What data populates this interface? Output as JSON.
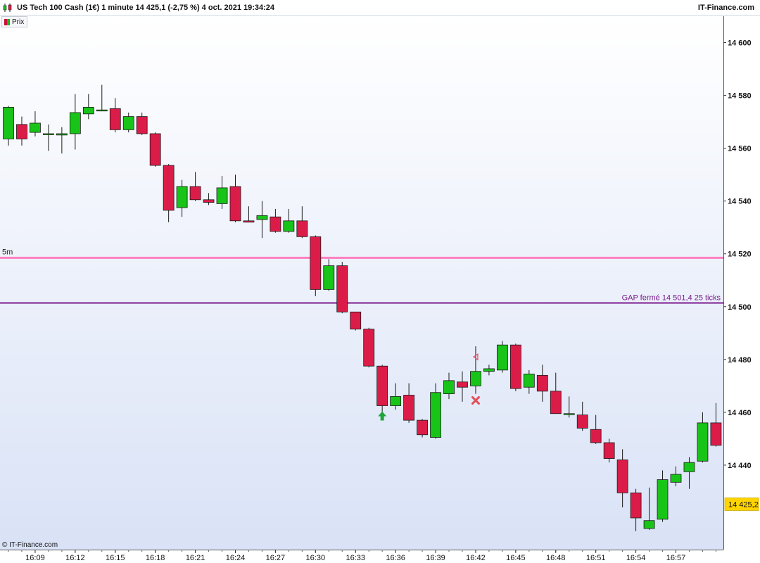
{
  "header": {
    "title": "US Tech 100 Cash (1€) 1 minute 14 425,1 (-2,75 %) 4 oct. 2021 19:34:24",
    "brand": "IT-Finance.com",
    "legend_label": "Prix"
  },
  "footer": {
    "copyright": "© IT-Finance.com"
  },
  "colors": {
    "up": "#18c418",
    "down": "#dc1c48",
    "pink_line": "#ff7fc0",
    "purple_line": "#7a1a8c",
    "bg_top": "#ffffff",
    "bg_bottom": "#d9e2f6"
  },
  "chart_data": {
    "type": "candlestick",
    "instrument": "US Tech 100 Cash (1€)",
    "interval": "1 minute",
    "ylim": [
      14408,
      14610
    ],
    "y_ticks": [
      14440,
      14460,
      14480,
      14500,
      14520,
      14540,
      14560,
      14580,
      14600
    ],
    "y_tick_labels": [
      "14 440",
      "14 460",
      "14 480",
      "14 500",
      "14 520",
      "14 540",
      "14 560",
      "14 580",
      "14 600"
    ],
    "x_tick_labels": [
      "16:09",
      "16:12",
      "16:15",
      "16:18",
      "16:21",
      "16:24",
      "16:27",
      "16:30",
      "16:33",
      "16:36",
      "16:39",
      "16:42",
      "16:45",
      "16:48",
      "16:51",
      "16:54",
      "16:57"
    ],
    "x_tick_candle_index": [
      2,
      5,
      8,
      11,
      14,
      17,
      20,
      23,
      26,
      29,
      32,
      35,
      38,
      41,
      44,
      47,
      50
    ],
    "candles": [
      {
        "o": 14563.5,
        "h": 14576,
        "l": 14561,
        "c": 14575.5
      },
      {
        "o": 14569,
        "h": 14572,
        "l": 14561,
        "c": 14563.5
      },
      {
        "o": 14566,
        "h": 14574,
        "l": 14564.5,
        "c": 14569.5
      },
      {
        "o": 14565.5,
        "h": 14569,
        "l": 14559,
        "c": 14565.5
      },
      {
        "o": 14565,
        "h": 14568,
        "l": 14558,
        "c": 14565.5
      },
      {
        "o": 14565.5,
        "h": 14580.5,
        "l": 14559.5,
        "c": 14573.5
      },
      {
        "o": 14573,
        "h": 14580.5,
        "l": 14571,
        "c": 14575.5
      },
      {
        "o": 14574.5,
        "h": 14584,
        "l": 14574,
        "c": 14574.5
      },
      {
        "o": 14575,
        "h": 14579,
        "l": 14566,
        "c": 14567
      },
      {
        "o": 14567,
        "h": 14573.5,
        "l": 14566,
        "c": 14572
      },
      {
        "o": 14572,
        "h": 14573.5,
        "l": 14565,
        "c": 14565.5
      },
      {
        "o": 14565.5,
        "h": 14566,
        "l": 14553,
        "c": 14553.5
      },
      {
        "o": 14553.5,
        "h": 14554,
        "l": 14532,
        "c": 14536.5
      },
      {
        "o": 14537.5,
        "h": 14548,
        "l": 14534,
        "c": 14545.5
      },
      {
        "o": 14545.5,
        "h": 14551,
        "l": 14540,
        "c": 14540.5
      },
      {
        "o": 14540.5,
        "h": 14543,
        "l": 14538.5,
        "c": 14539.5
      },
      {
        "o": 14539,
        "h": 14549.5,
        "l": 14537,
        "c": 14545
      },
      {
        "o": 14545.5,
        "h": 14550,
        "l": 14532,
        "c": 14532.5
      },
      {
        "o": 14532.5,
        "h": 14538,
        "l": 14532,
        "c": 14532
      },
      {
        "o": 14533,
        "h": 14540,
        "l": 14526,
        "c": 14534.5
      },
      {
        "o": 14534,
        "h": 14537,
        "l": 14528,
        "c": 14528.5
      },
      {
        "o": 14528.5,
        "h": 14537,
        "l": 14528,
        "c": 14532.5
      },
      {
        "o": 14532.5,
        "h": 14538,
        "l": 14526,
        "c": 14526.5
      },
      {
        "o": 14526.5,
        "h": 14527,
        "l": 14504,
        "c": 14506.5
      },
      {
        "o": 14506.5,
        "h": 14518,
        "l": 14506,
        "c": 14515.5
      },
      {
        "o": 14515.5,
        "h": 14517,
        "l": 14497.5,
        "c": 14498
      },
      {
        "o": 14498,
        "h": 14498,
        "l": 14491,
        "c": 14491.5
      },
      {
        "o": 14491.5,
        "h": 14492,
        "l": 14477,
        "c": 14477.5
      },
      {
        "o": 14477.5,
        "h": 14478,
        "l": 14460,
        "c": 14462.5
      },
      {
        "o": 14462.5,
        "h": 14471,
        "l": 14461,
        "c": 14466
      },
      {
        "o": 14466.5,
        "h": 14471,
        "l": 14456,
        "c": 14457
      },
      {
        "o": 14457,
        "h": 14457.5,
        "l": 14450.5,
        "c": 14451.5
      },
      {
        "o": 14450.5,
        "h": 14471,
        "l": 14450,
        "c": 14467.5
      },
      {
        "o": 14467,
        "h": 14475,
        "l": 14465,
        "c": 14472
      },
      {
        "o": 14471.5,
        "h": 14475.5,
        "l": 14464,
        "c": 14469.5
      },
      {
        "o": 14470,
        "h": 14485,
        "l": 14467,
        "c": 14475.5
      },
      {
        "o": 14475.5,
        "h": 14478,
        "l": 14474,
        "c": 14476.5
      },
      {
        "o": 14476,
        "h": 14487,
        "l": 14475,
        "c": 14485.5
      },
      {
        "o": 14485.5,
        "h": 14486,
        "l": 14468,
        "c": 14469
      },
      {
        "o": 14469.5,
        "h": 14476,
        "l": 14467,
        "c": 14474.5
      },
      {
        "o": 14474,
        "h": 14478,
        "l": 14464,
        "c": 14468
      },
      {
        "o": 14468,
        "h": 14475,
        "l": 14460,
        "c": 14459.5
      },
      {
        "o": 14459.5,
        "h": 14466,
        "l": 14458,
        "c": 14459.5
      },
      {
        "o": 14459,
        "h": 14464,
        "l": 14453,
        "c": 14454
      },
      {
        "o": 14453.5,
        "h": 14459,
        "l": 14448,
        "c": 14448.5
      },
      {
        "o": 14448.5,
        "h": 14450,
        "l": 14441,
        "c": 14442.5
      },
      {
        "o": 14442,
        "h": 14446,
        "l": 14424,
        "c": 14429.5
      },
      {
        "o": 14429.5,
        "h": 14431,
        "l": 14415,
        "c": 14420
      },
      {
        "o": 14416,
        "h": 14431.5,
        "l": 14415.5,
        "c": 14419
      },
      {
        "o": 14419.5,
        "h": 14438,
        "l": 14418.5,
        "c": 14434.5
      },
      {
        "o": 14433.5,
        "h": 14439.5,
        "l": 14432,
        "c": 14436.5
      },
      {
        "o": 14437.5,
        "h": 14443,
        "l": 14431,
        "c": 14441
      },
      {
        "o": 14441.5,
        "h": 14460,
        "l": 14441,
        "c": 14456
      },
      {
        "o": 14456,
        "h": 14463.5,
        "l": 14447,
        "c": 14447.5
      }
    ],
    "hlines": [
      {
        "value": 14518.5,
        "label": "5m",
        "label_side": "left",
        "color": "#ff7fc0"
      },
      {
        "value": 14501.4,
        "label": "GAP fermé 14 501,4 25 ticks",
        "label_side": "right",
        "color": "#7a1a8c"
      }
    ],
    "markers": [
      {
        "type": "arrow-up",
        "candle_index": 28,
        "price": 14458.5,
        "color": "#1fa63a"
      },
      {
        "type": "cross",
        "candle_index": 35,
        "price": 14464.5,
        "color": "#e0505a"
      },
      {
        "type": "triangle-left",
        "candle_index": 35,
        "price": 14481,
        "color": "#e0505a"
      }
    ],
    "last_price_label": "14 425,2",
    "last_price": 14425.2
  }
}
